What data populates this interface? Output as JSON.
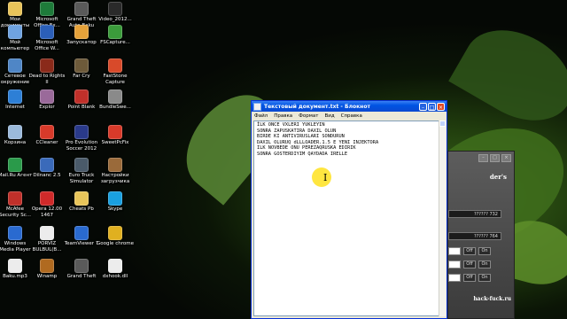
{
  "desktop_icons": [
    {
      "label": "Мои\nдокументы",
      "icon": "folder-icon",
      "color": "#e8c45a"
    },
    {
      "label": "Microsoft\nOffice Ex...",
      "icon": "excel-icon",
      "color": "#1e7b3a"
    },
    {
      "label": "Grand Theft\nAuto Baku",
      "icon": "game-icon",
      "color": "#5a5a5a"
    },
    {
      "label": "Video_2012...",
      "icon": "video-icon",
      "color": "#2a2a2a"
    },
    {
      "label": "Мой\nкомпьютер",
      "icon": "computer-icon",
      "color": "#6fa3e0"
    },
    {
      "label": "Microsoft\nOffice W...",
      "icon": "word-icon",
      "color": "#2b5fb8"
    },
    {
      "label": "Запускатор",
      "icon": "launcher-icon",
      "color": "#e5a23a"
    },
    {
      "label": "FSCapture...",
      "icon": "capture-icon",
      "color": "#3b9c3b"
    },
    {
      "label": "Сетевое\nокружение",
      "icon": "network-icon",
      "color": "#4f86c6"
    },
    {
      "label": "Dead to Rights\nII",
      "icon": "game-icon",
      "color": "#8a2a1a"
    },
    {
      "label": "Far Cry",
      "icon": "game-icon",
      "color": "#6d5a3a"
    },
    {
      "label": "FastStone\nCapture",
      "icon": "faststone-icon",
      "color": "#d84a2a"
    },
    {
      "label": "Internet",
      "icon": "internet-explorer-icon",
      "color": "#2d7fd6"
    },
    {
      "label": "Explor",
      "icon": "explorer-icon",
      "color": "#9a6a9a"
    },
    {
      "label": "Point Blank",
      "icon": "point-blank-icon",
      "color": "#c0302a"
    },
    {
      "label": "BundleSwe...",
      "icon": "bundle-icon",
      "color": "#8a8a8a"
    },
    {
      "label": "Корзина",
      "icon": "recycle-bin-icon",
      "color": "#9bbadb"
    },
    {
      "label": "CCleaner",
      "icon": "ccleaner-icon",
      "color": "#d83a2a"
    },
    {
      "label": "Pro Evolution\nSoccer 2012",
      "icon": "pes-icon",
      "color": "#2a3a8a"
    },
    {
      "label": "SweetPcFix",
      "icon": "sweetpcfix-icon",
      "color": "#d83a2a"
    },
    {
      "label": "Mail.Ru Агент",
      "icon": "mail-agent-icon",
      "color": "#2a9a4a"
    },
    {
      "label": "Dilnanc 2.5",
      "icon": "dilnanc-icon",
      "color": "#3a6aba"
    },
    {
      "label": "Euro Truck\nSimulator",
      "icon": "truck-icon",
      "color": "#4a5a6a"
    },
    {
      "label": "Настройки\nзагрузчика",
      "icon": "settings-icon",
      "color": "#9a6a3a"
    },
    {
      "label": "McAfee\nSecurity Sc...",
      "icon": "mcafee-icon",
      "color": "#c0302a"
    },
    {
      "label": "Opera 12.00\n1467",
      "icon": "opera-icon",
      "color": "#d02a2a"
    },
    {
      "label": "Cheats Pb",
      "icon": "folder-icon",
      "color": "#e8c45a"
    },
    {
      "label": "Skype",
      "icon": "skype-icon",
      "color": "#1aa0e0"
    },
    {
      "label": "Windows\nMedia Player",
      "icon": "media-player-icon",
      "color": "#2a6ad0"
    },
    {
      "label": "PORVIZ\nBULBUL(B...",
      "icon": "document-icon",
      "color": "#ececec"
    },
    {
      "label": "TeamViewer 7",
      "icon": "teamviewer-icon",
      "color": "#2a6ad0"
    },
    {
      "label": "Google chrome",
      "icon": "chrome-icon",
      "color": "#e0b020"
    },
    {
      "label": "Baku.mp3",
      "icon": "audio-icon",
      "color": "#ececec"
    },
    {
      "label": "Winamp",
      "icon": "winamp-icon",
      "color": "#b06a20"
    },
    {
      "label": "Grand Theft",
      "icon": "game-icon",
      "color": "#5a5a5a"
    },
    {
      "label": "dxhook.dll",
      "icon": "dll-icon",
      "color": "#ececec"
    }
  ],
  "notepad": {
    "title": "Текстовый документ.txt - Блокнот",
    "menu": [
      "Файл",
      "Правка",
      "Формат",
      "Вид",
      "Справка"
    ],
    "lines": [
      "İLK ONCE VXLERI YUKLEYIN",
      "SONRA ZAPUSKATIRA DAXIL OLUN",
      "BIRDE KI ANTIVIRUSLARI SONDURUN",
      "DAXIL OLURUQ dLLLOADER.1.5 E YENI INJEKTORA",
      "ILK NOVBEDE ONU PEREZAQRUSKA EDIRIK",
      "SONRA GOSTERDIYIM QAYDADA IRELLE"
    ]
  },
  "trainer": {
    "title": "der's",
    "fields": [
      "?????? 732",
      "?????? 764"
    ],
    "toggles": [
      [
        "Off",
        "On"
      ],
      [
        "Off",
        "On"
      ],
      [
        "Off",
        "On"
      ]
    ],
    "site": "hack-fuck.ru"
  }
}
